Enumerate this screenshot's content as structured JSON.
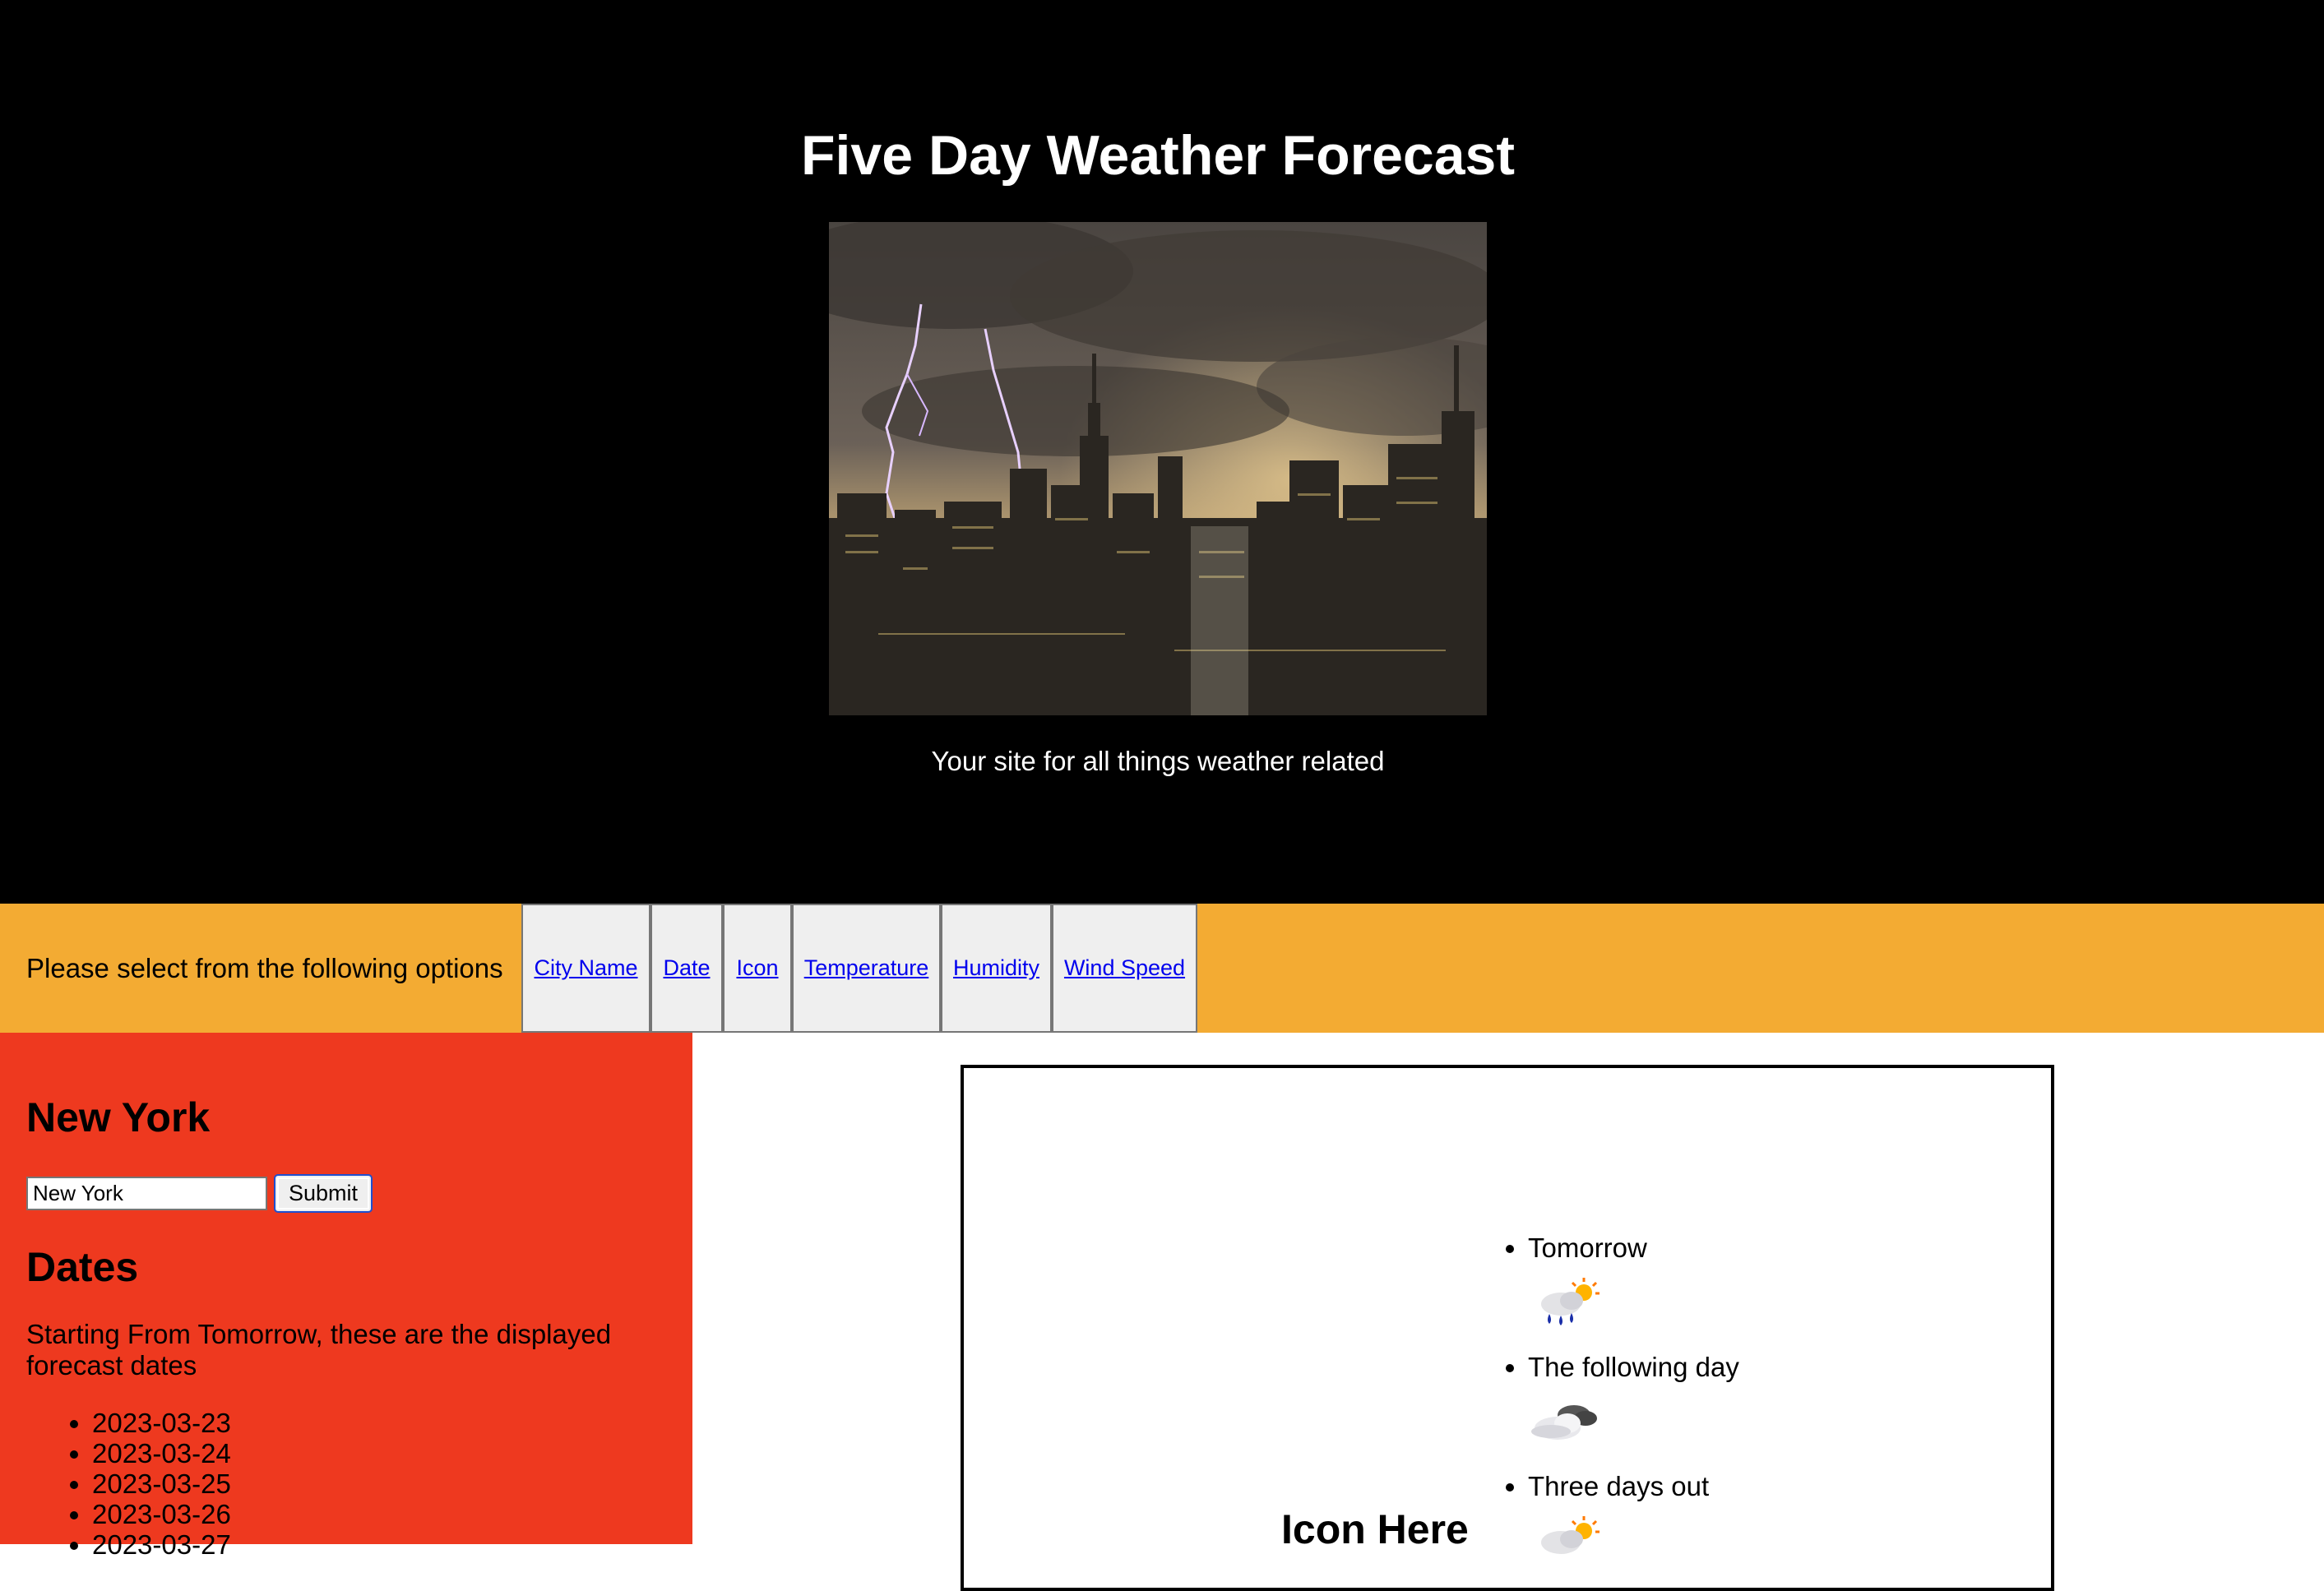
{
  "header": {
    "title": "Five Day Weather Forecast",
    "tagline": "Your site for all things weather related"
  },
  "nav": {
    "prompt": "Please select from the following options",
    "options": [
      "City Name",
      "Date",
      "Icon",
      "Temperature",
      "Humidity",
      "Wind Speed"
    ]
  },
  "sidebar": {
    "city": "New York",
    "input_value": "New York",
    "submit_label": "Submit",
    "dates_heading": "Dates",
    "dates_description": "Starting From Tomorrow, these are the displayed forecast dates",
    "dates": [
      "2023-03-23",
      "2023-03-24",
      "2023-03-25",
      "2023-03-26",
      "2023-03-27"
    ]
  },
  "main": {
    "icon_heading": "Icon Here",
    "forecast": [
      {
        "label": "Tomorrow",
        "icon": "rain-sun-icon"
      },
      {
        "label": "The following day",
        "icon": "cloudy-icon"
      },
      {
        "label": "Three days out",
        "icon": "rain-sun-icon"
      }
    ]
  },
  "colors": {
    "header_bg": "#000000",
    "nav_bg": "#f3ab33",
    "sidebar_bg": "#ee391f",
    "link": "#0000ee",
    "button_bg": "#efefef"
  }
}
